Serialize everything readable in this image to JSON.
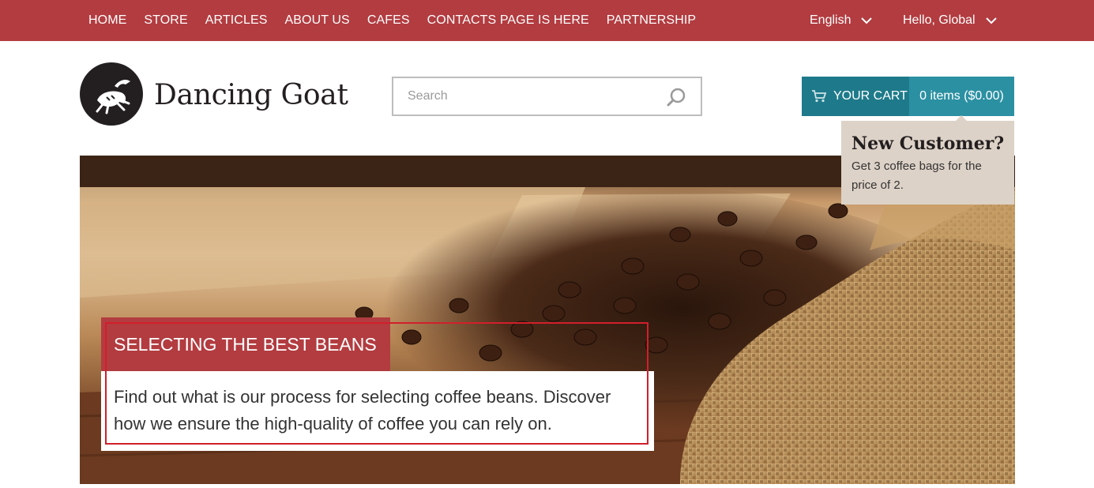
{
  "nav": {
    "items": [
      "HOME",
      "STORE",
      "ARTICLES",
      "ABOUT US",
      "CAFES",
      "CONTACTS PAGE IS HERE",
      "PARTNERSHIP"
    ],
    "language": "English",
    "greeting": "Hello, Global"
  },
  "header": {
    "brand": "Dancing Goat",
    "search_placeholder": "Search",
    "cart_label": "YOUR CART",
    "cart_summary": "0 items ($0.00)"
  },
  "promo": {
    "title": "New Customer?",
    "text": "Get 3 coffee bags for the price of 2."
  },
  "hero": {
    "title": "SELECTING THE BEST BEANS",
    "text": "Find out what is our process for selecting coffee beans. Discover how we ensure the high-quality of coffee you can rely on."
  },
  "colors": {
    "nav_bg": "#b23c40",
    "cart_dark": "#1e7a8a",
    "cart_light": "#2b90a2",
    "promo_bg": "#ddd2c7",
    "highlight_border": "#d21f2b"
  },
  "icons": [
    "chevron-down-icon",
    "search-icon",
    "cart-icon",
    "goat-logo-icon"
  ]
}
